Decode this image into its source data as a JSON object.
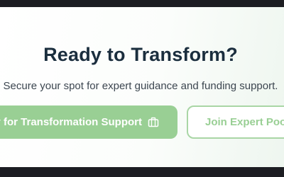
{
  "cta": {
    "title": "Ready to Transform?",
    "subtitle": "Secure your spot for expert guidance and funding support.",
    "primary_button": {
      "label": "ply for Transformation Support",
      "icon": "briefcase-icon"
    },
    "secondary_button": {
      "label": "Join Expert Pool"
    }
  },
  "colors": {
    "heading": "#1b2e3e",
    "primary_button_bg": "#99cf94",
    "secondary_button_border": "#a9d6a5",
    "backdrop": "#1c1d22"
  }
}
